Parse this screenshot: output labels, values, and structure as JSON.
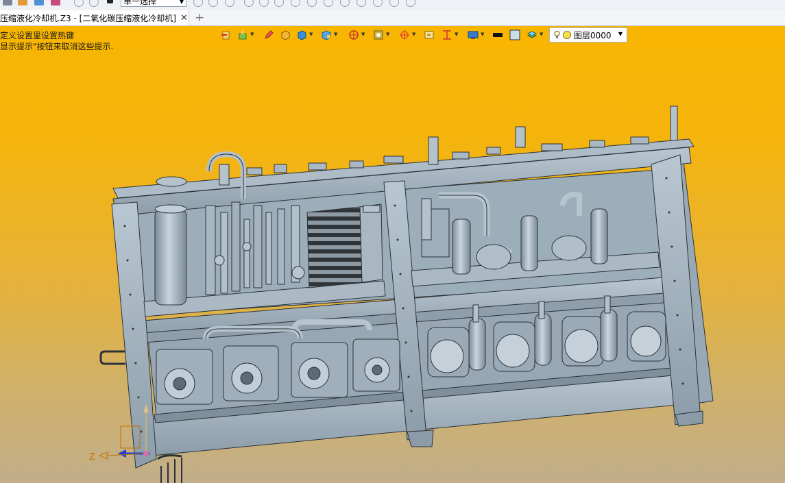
{
  "quick_access": {
    "selection_mode": "单一选择"
  },
  "tabs": {
    "document_title": "压缩液化冷却机.Z3 - [二氧化碳压缩液化冷却机]",
    "close_symbol": "✕",
    "new_tab_symbol": "+"
  },
  "viewport": {
    "hint_line1": "定义设置里设置热键",
    "hint_line2": "显示提示\"按钮来取消这些提示.",
    "axis_z_label": "Z"
  },
  "view_toolbar": {
    "layer_name": "图层0000",
    "icons": [
      "exit-view-icon",
      "render-mode-icon",
      "pencil-icon",
      "solid-box-icon",
      "shaded-box-icon",
      "view-cube-icon",
      "section-view-icon",
      "frame-icon",
      "target-icon",
      "select-box-icon",
      "align-icon",
      "display-icon",
      "black-color-swatch",
      "white-color-swatch",
      "layers-icon"
    ]
  },
  "colors": {
    "viewport_top": "#f8b500",
    "viewport_bottom": "#c2ae89",
    "model_fill": "#a5b5c1",
    "model_line": "#2b3238"
  }
}
